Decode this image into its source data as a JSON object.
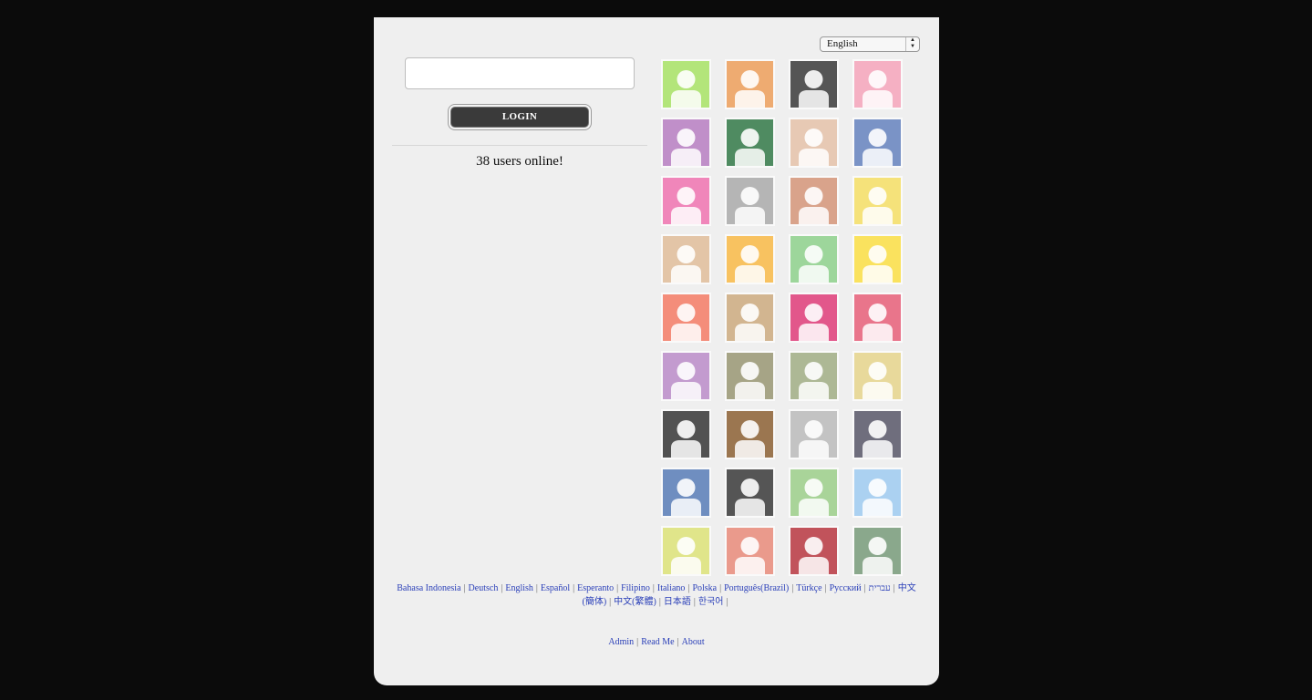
{
  "language_select": {
    "value": "English"
  },
  "login": {
    "name_value": "",
    "button_label": "LOGIN"
  },
  "online_text": "38 users online!",
  "avatars": [
    {
      "color": "#b3e57a",
      "icon": "top-hat-avatar-icon"
    },
    {
      "color": "#eeab71",
      "icon": "bear-avatar-icon"
    },
    {
      "color": "#555555",
      "icon": "fedora-avatar-icon"
    },
    {
      "color": "#f5b0c3",
      "icon": "long-hair-girl-avatar-icon"
    },
    {
      "color": "#c08fc9",
      "icon": "bun-girl-avatar-icon"
    },
    {
      "color": "#4f8b61",
      "icon": "spiky-hair-avatar-icon"
    },
    {
      "color": "#e7c9b4",
      "icon": "blob-avatar-icon"
    },
    {
      "color": "#7a93c6",
      "icon": "robot-avatar-icon"
    },
    {
      "color": "#f086ba",
      "icon": "braids-girl-avatar-icon"
    },
    {
      "color": "#b5b5b5",
      "icon": "glasses-man-avatar-icon"
    },
    {
      "color": "#d9a38b",
      "icon": "maid-avatar-icon"
    },
    {
      "color": "#f5e27a",
      "icon": "flower-avatar-icon"
    },
    {
      "color": "#e3c5a7",
      "icon": "boy-avatar-icon"
    },
    {
      "color": "#f8c260",
      "icon": "pigtails-girl-avatar-icon"
    },
    {
      "color": "#9dd69b",
      "icon": "frog-avatar-icon"
    },
    {
      "color": "#fae25e",
      "icon": "simple-person-avatar-icon"
    },
    {
      "color": "#f48d7a",
      "icon": "curly-girl-avatar-icon"
    },
    {
      "color": "#d2b590",
      "icon": "cat-shirt-boy-avatar-icon"
    },
    {
      "color": "#e2578b",
      "icon": "maid-girl-avatar-icon"
    },
    {
      "color": "#e9758b",
      "icon": "knight-avatar-icon"
    },
    {
      "color": "#c39bcf",
      "icon": "hat-girl-avatar-icon"
    },
    {
      "color": "#a6a486",
      "icon": "short-hair-avatar-icon"
    },
    {
      "color": "#adb895",
      "icon": "spiky-scarf-avatar-icon"
    },
    {
      "color": "#e8d99b",
      "icon": "cat-ears-avatar-icon"
    },
    {
      "color": "#525252",
      "icon": "headphones-avatar-icon"
    },
    {
      "color": "#9b7650",
      "icon": "gas-mask-avatar-icon"
    },
    {
      "color": "#c3c3c3",
      "icon": "plain-avatar-icon"
    },
    {
      "color": "#6f6e7d",
      "icon": "bowtie-avatar-icon"
    },
    {
      "color": "#6f8ec0",
      "icon": "sailor-avatar-icon"
    },
    {
      "color": "#555555",
      "icon": "tuxedo-avatar-icon"
    },
    {
      "color": "#a9d499",
      "icon": "ribbon-girl-avatar-icon"
    },
    {
      "color": "#abd1f1",
      "icon": "light-blue-avatar-icon"
    },
    {
      "color": "#e0e58a",
      "icon": "bald-avatar-icon"
    },
    {
      "color": "#ea9a8c",
      "icon": "salmon-girl-avatar-icon"
    },
    {
      "color": "#c1535b",
      "icon": "nurse-avatar-icon"
    },
    {
      "color": "#8aa88c",
      "icon": "cap-avatar-icon"
    }
  ],
  "language_links": [
    "Bahasa Indonesia",
    "Deutsch",
    "English",
    "Español",
    "Esperanto",
    "Filipino",
    "Italiano",
    "Polska",
    "Português(Brazil)",
    "Türkçe",
    "Русский",
    "עברית",
    "中文(簡体)",
    "中文(繁體)",
    "日本語",
    "한국어"
  ],
  "footer_links": [
    "Admin",
    "Read Me",
    "About"
  ]
}
